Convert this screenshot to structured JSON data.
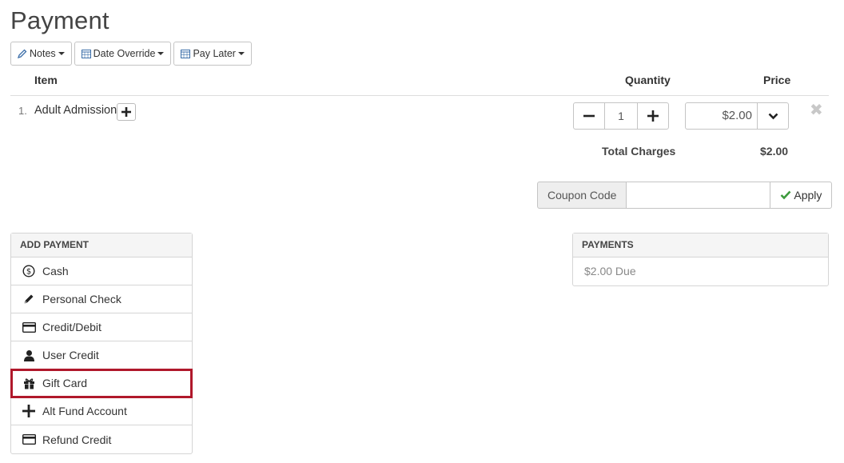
{
  "page": {
    "title": "Payment"
  },
  "toolbar": {
    "notes_label": "Notes",
    "date_override_label": "Date Override",
    "pay_later_label": "Pay Later"
  },
  "table": {
    "columns": {
      "item": "Item",
      "quantity": "Quantity",
      "price": "Price"
    },
    "rows": [
      {
        "num": "1.",
        "name": "Adult Admission",
        "quantity": "1",
        "price": "$2.00"
      }
    ],
    "total_label": "Total Charges",
    "total_value": "$2.00"
  },
  "coupon": {
    "label": "Coupon Code",
    "value": "",
    "apply_label": "Apply"
  },
  "add_payment": {
    "heading": "ADD PAYMENT",
    "items": [
      {
        "label": "Cash",
        "icon": "dollar-circle-icon"
      },
      {
        "label": "Personal Check",
        "icon": "pen-icon"
      },
      {
        "label": "Credit/Debit",
        "icon": "credit-card-icon"
      },
      {
        "label": "User Credit",
        "icon": "user-icon"
      },
      {
        "label": "Gift Card",
        "icon": "gift-icon",
        "selected": true
      },
      {
        "label": "Alt Fund Account",
        "icon": "plus-icon"
      },
      {
        "label": "Refund Credit",
        "icon": "credit-card-icon"
      }
    ]
  },
  "payments": {
    "heading": "PAYMENTS",
    "due_text": "$2.00 Due"
  },
  "colors": {
    "highlight": "#b0182b",
    "check": "#3c9a3c"
  }
}
